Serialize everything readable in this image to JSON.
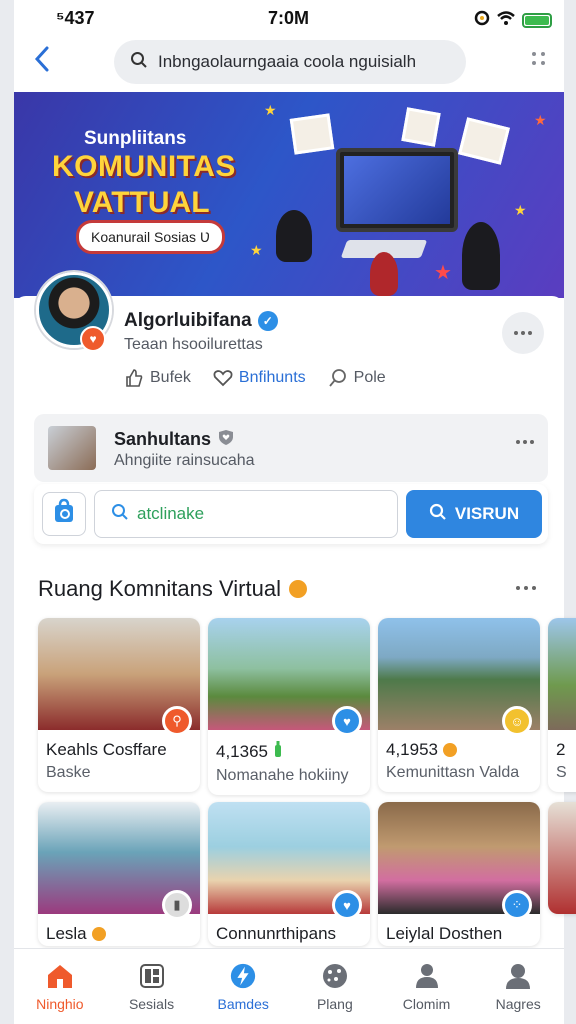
{
  "status_bar": {
    "signal": "⁵437",
    "time": "7:0M"
  },
  "search": {
    "text": "Inbngaolaurngaaia coola nguisialh"
  },
  "banner": {
    "line1": "Sunpliitans",
    "line2": "KOMUNITAS",
    "line3": "VATTUAL",
    "pill": "Koanurail Sosias Ʋ"
  },
  "profile": {
    "name": "Algorluibifana",
    "subtitle": "Teaan hsooilurettas",
    "actions": [
      {
        "label": "Bufek"
      },
      {
        "label": "Bnfihunts"
      },
      {
        "label": "Pole"
      }
    ]
  },
  "group": {
    "name": "Sanhultans",
    "subtitle": "Ahngiite rainsucaha"
  },
  "group_search": {
    "value": "atclinake",
    "button": "VISRUN"
  },
  "section": {
    "title": "Ruang Komnitans Virtual"
  },
  "cards": [
    {
      "title": "Keahls Cosffare",
      "subtitle": "Baske",
      "badge_color": "#ef5a2c"
    },
    {
      "title": "4,1365",
      "subtitle": "Nomanahe hokiiny",
      "badge_color": "#2d8fe6"
    },
    {
      "title": "4,1953",
      "subtitle": "Kemunittasn Valda",
      "badge_color": "#f2c12e"
    },
    {
      "title": "2",
      "subtitle": "S",
      "badge_color": "#2d8fe6"
    },
    {
      "title": "Lesla",
      "subtitle": "",
      "badge_color": "#dddddd"
    },
    {
      "title": "Connunrthipans",
      "subtitle": "",
      "badge_color": "#2d8fe6"
    },
    {
      "title": "Leiylal Dosthen",
      "subtitle": "",
      "badge_color": "#2d8fe6"
    }
  ],
  "tabs": [
    {
      "label": "Ninghio"
    },
    {
      "label": "Sesials"
    },
    {
      "label": "Bamdes"
    },
    {
      "label": "Plang"
    },
    {
      "label": "Clomim"
    },
    {
      "label": "Nagres"
    }
  ],
  "colors": {
    "accent": "#2a6fd6",
    "home_active": "#ef5a2c",
    "button": "#2f86e0"
  }
}
